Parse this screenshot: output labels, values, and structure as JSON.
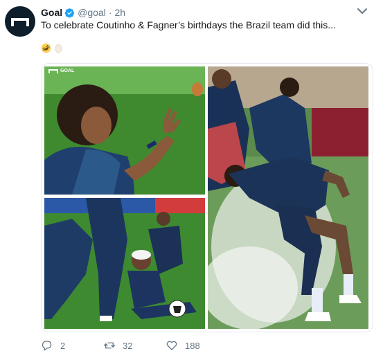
{
  "account": {
    "name": "Goal",
    "handle": "@goal",
    "separator": "·",
    "time": "2h",
    "verified": true,
    "avatar_icon": "goal-logo-icon"
  },
  "tweet": {
    "text": "To celebrate Coutinho & Fagner’s birthdays the Brazil team did this...",
    "emojis": [
      "rolling-on-floor-laughing",
      "egg"
    ]
  },
  "media": {
    "photo_count": 3,
    "watermark": "GOAL",
    "photos": [
      {
        "alt": "player-about-to-be-hit-by-egg"
      },
      {
        "alt": "player-hit-by-flour-and-egg"
      },
      {
        "alt": "player-covered-in-flour-spray"
      }
    ]
  },
  "actions": {
    "reply_count": "2",
    "retweet_count": "32",
    "like_count": "188"
  },
  "colors": {
    "text": "#14171a",
    "secondary": "#657786",
    "verified": "#1da1f2",
    "border": "#e1e8ed"
  }
}
